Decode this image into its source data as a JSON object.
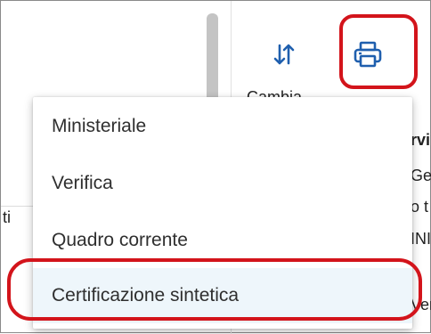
{
  "toolbar": {
    "sort_icon": "sort-arrows-icon",
    "print_icon": "printer-icon"
  },
  "background": {
    "partial_header": "Cambia",
    "left_fragment": "ti",
    "right_fragments": [
      "rvi",
      "Ge",
      "o t",
      "INI",
      "Ver"
    ]
  },
  "menu": {
    "items": [
      {
        "label": "Ministeriale"
      },
      {
        "label": "Verifica"
      },
      {
        "label": "Quadro corrente"
      },
      {
        "label": "Certificazione sintetica"
      }
    ]
  },
  "colors": {
    "accent_blue": "#1f5fae",
    "highlight_red": "#d3141b"
  }
}
